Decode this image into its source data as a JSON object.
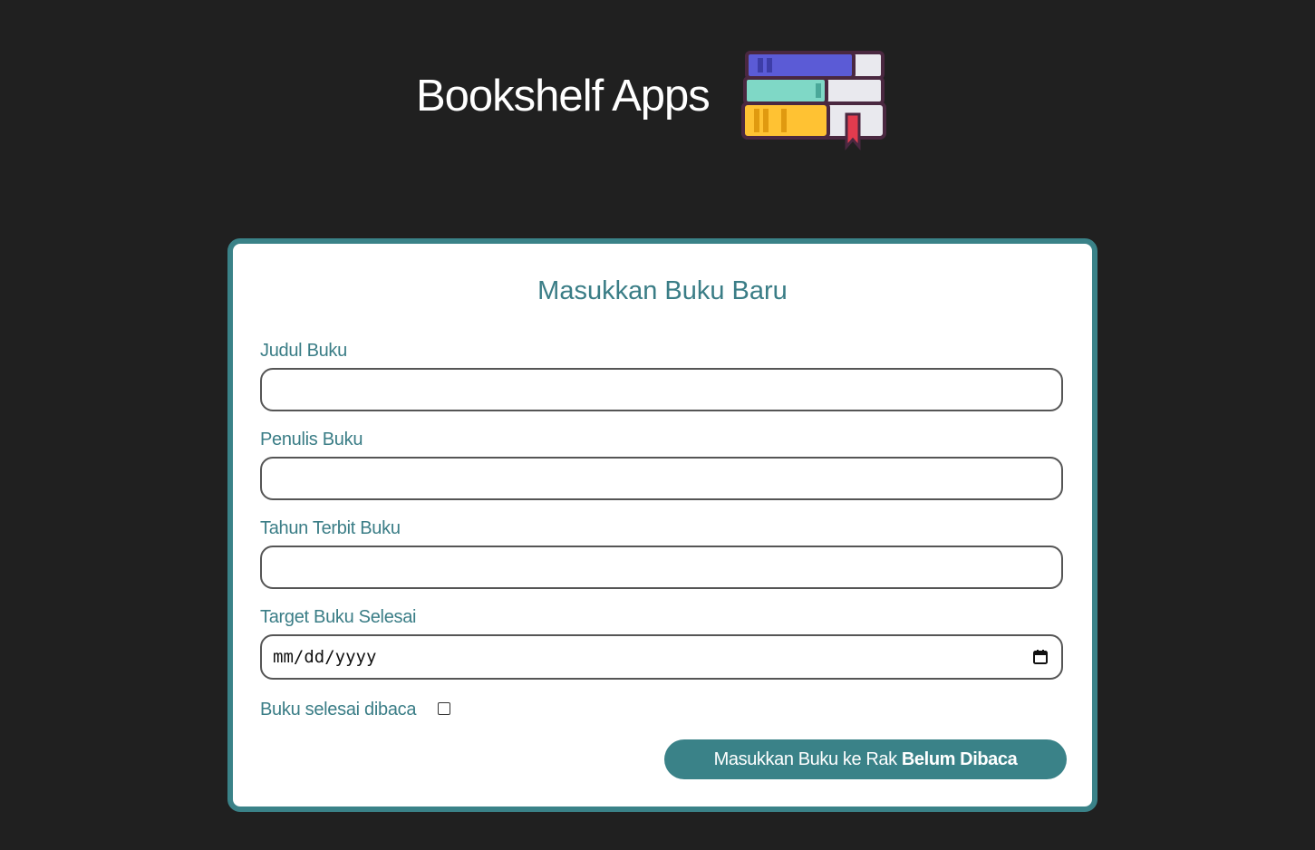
{
  "header": {
    "title": "Bookshelf Apps",
    "logo_icon": "stacked-books-icon"
  },
  "form": {
    "title": "Masukkan Buku Baru",
    "fields": [
      {
        "label": "Judul Buku",
        "value": "",
        "type": "text"
      },
      {
        "label": "Penulis Buku",
        "value": "",
        "type": "text"
      },
      {
        "label": "Tahun Terbit Buku",
        "value": "",
        "type": "number"
      },
      {
        "label": "Target Buku Selesai",
        "value": "",
        "type": "date",
        "placeholder": "mm/dd/yyyy"
      }
    ],
    "checkbox": {
      "label": "Buku selesai dibaca",
      "checked": false
    },
    "submit": {
      "prefix": "Masukkan Buku ke Rak ",
      "shelf": "Belum Dibaca"
    }
  },
  "colors": {
    "background": "#202020",
    "accent": "#3a8288",
    "label": "#3a7d86"
  }
}
